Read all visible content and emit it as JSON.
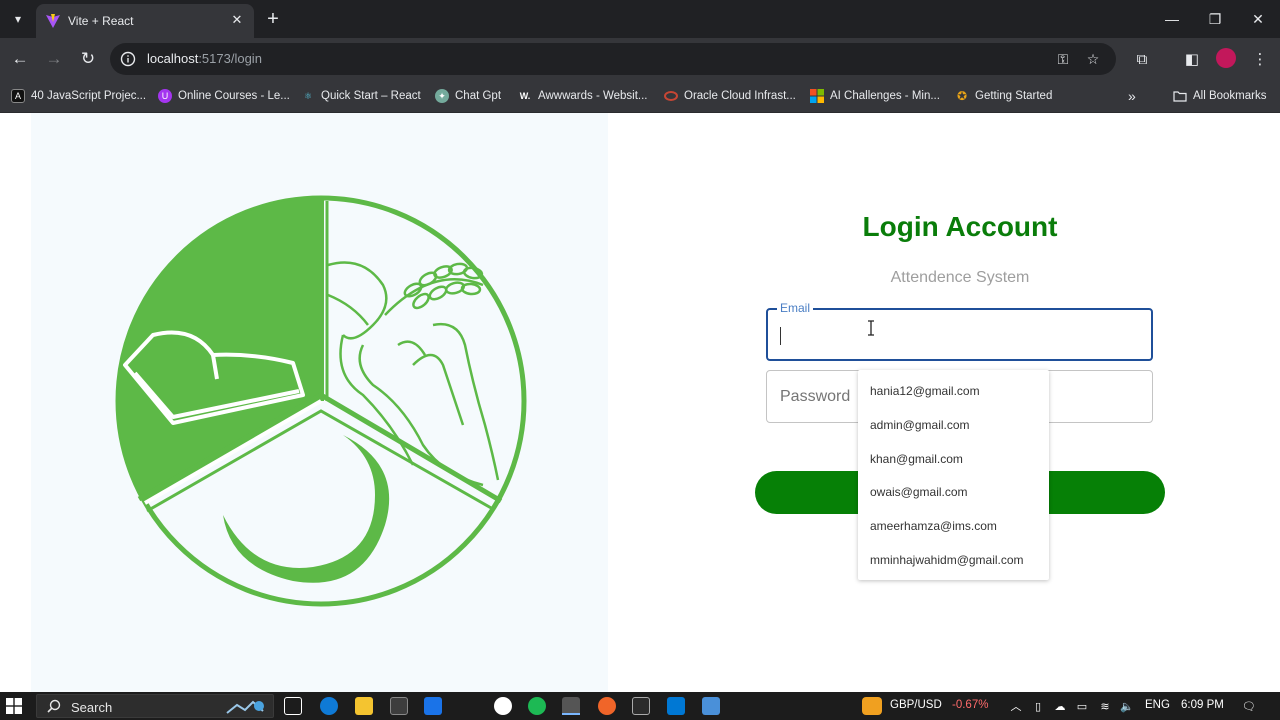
{
  "browser": {
    "tab_title": "Vite + React",
    "url_host": "localhost",
    "url_path": ":5173/login",
    "bookmarks": [
      {
        "label": "40 JavaScript Projec...",
        "color": "#111111",
        "glyph": "A"
      },
      {
        "label": "Online Courses - Le...",
        "color": "#a435f0",
        "glyph": "U"
      },
      {
        "label": "Quick Start – React",
        "color": "#087ea4",
        "glyph": "⚛"
      },
      {
        "label": "Chat Gpt",
        "color": "#74aa9c",
        "glyph": "✦"
      },
      {
        "label": "Awwwards - Websit...",
        "color": "#222222",
        "glyph": "W."
      },
      {
        "label": "Oracle Cloud Infrast...",
        "color": "#c74634",
        "glyph": "○"
      },
      {
        "label": "AI Challenges - Min...",
        "color": "#f25022",
        "glyph": "▦"
      },
      {
        "label": "Getting Started",
        "color": "#e8a317",
        "glyph": "✪"
      }
    ],
    "all_bookmarks": "All Bookmarks"
  },
  "login": {
    "title": "Login Account",
    "subtitle": "Attendence System",
    "email_label": "Email",
    "email_value": "",
    "password_placeholder": "Password"
  },
  "autocomplete": [
    "hania12@gmail.com",
    "admin@gmail.com",
    "khan@gmail.com",
    "owais@gmail.com",
    "ameerhamza@ims.com",
    "mminhajwahidm@gmail.com"
  ],
  "taskbar": {
    "search_label": "Search",
    "ticker": "GBP/USD",
    "ticker_change": "-0.67%",
    "language": "ENG",
    "time": "6:09 PM"
  },
  "colors": {
    "brand_green": "#068006",
    "logo_green": "#5db947",
    "focus_blue": "#1f4f99",
    "ticker_red": "#ff6b6b"
  }
}
